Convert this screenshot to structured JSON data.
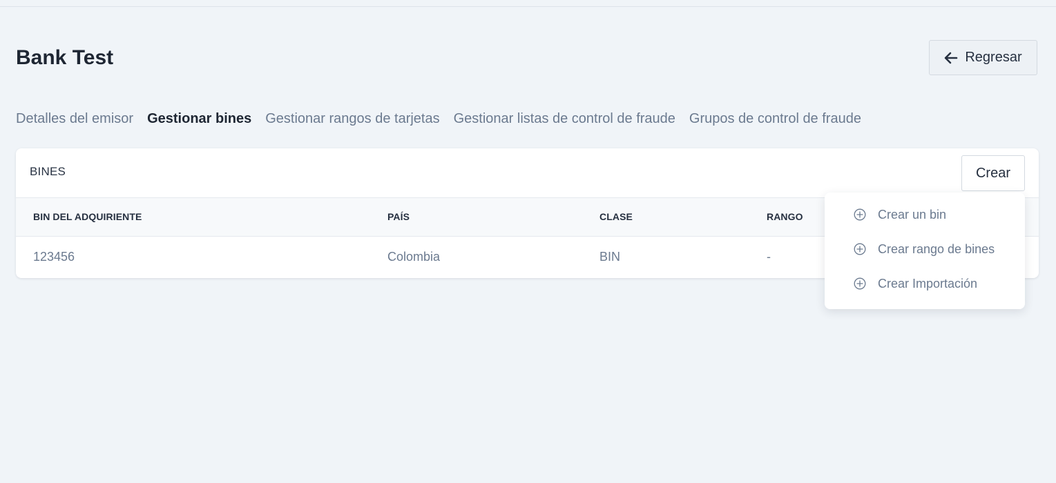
{
  "page": {
    "title": "Bank Test",
    "back_label": "Regresar"
  },
  "tabs": [
    {
      "label": "Detalles del emisor",
      "active": false
    },
    {
      "label": "Gestionar bines",
      "active": true
    },
    {
      "label": "Gestionar rangos de tarjetas",
      "active": false
    },
    {
      "label": "Gestionar listas de control de fraude",
      "active": false
    },
    {
      "label": "Grupos de control de fraude",
      "active": false
    }
  ],
  "card": {
    "title": "BINES",
    "create_label": "Crear"
  },
  "table": {
    "columns": [
      "BIN DEL ADQUIRIENTE",
      "PAÍS",
      "CLASE",
      "RANGO"
    ],
    "rows": [
      [
        "123456",
        "Colombia",
        "BIN",
        "-"
      ]
    ]
  },
  "create_menu": {
    "items": [
      {
        "label": "Crear un bin",
        "icon": "plus-circle-icon"
      },
      {
        "label": "Crear rango de bines",
        "icon": "plus-circle-icon"
      },
      {
        "label": "Crear Importación",
        "icon": "plus-circle-icon"
      }
    ]
  }
}
